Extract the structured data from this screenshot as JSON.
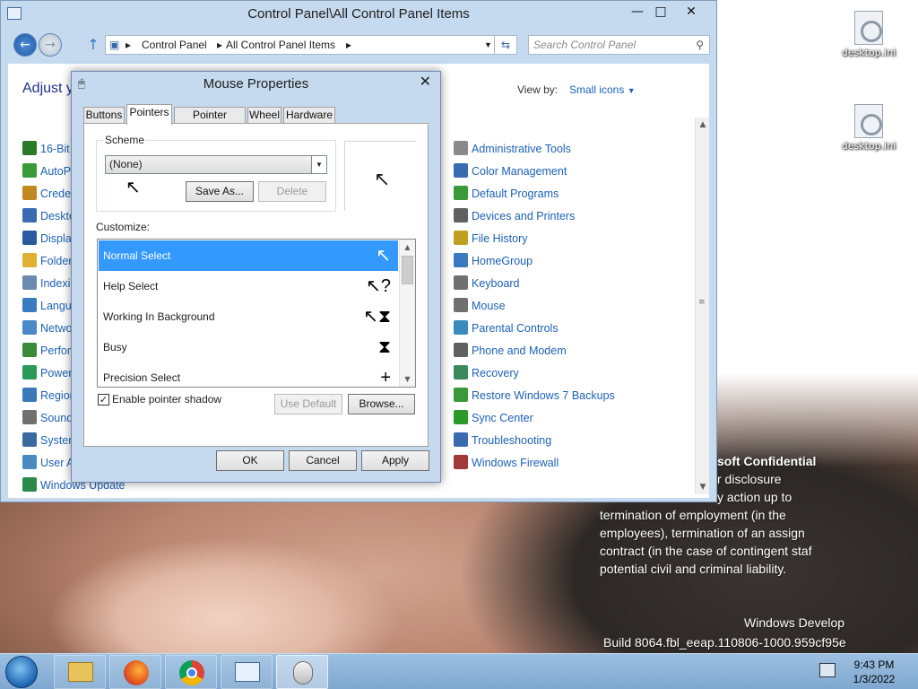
{
  "desktop": {
    "icons": [
      {
        "label": "desktop.ini"
      },
      {
        "label": "desktop.ini"
      }
    ],
    "watermark": {
      "line1": "soft Confidential",
      "line2": "r disclosure",
      "line3": "y action up to",
      "line4": "termination of employment (in the",
      "line5": "employees), termination of an assign",
      "line6": "contract (in the case of contingent staf",
      "line7": "potential civil and criminal liability.",
      "build_title": "Windows Develop",
      "build_number": "Build 8064.fbl_eeap.110806-1000.959cf95e"
    }
  },
  "control_panel": {
    "title": "Control Panel\\All Control Panel Items",
    "address": {
      "seg1": "Control Panel",
      "seg2": "All Control Panel Items"
    },
    "search_placeholder": "Search Control Panel",
    "heading": "Adjust y",
    "view_by_label": "View by:",
    "view_by_value": "Small icons",
    "left_items": [
      {
        "label": "16-Bit",
        "color": "#2a7a2a"
      },
      {
        "label": "AutoP",
        "color": "#3a9a3a"
      },
      {
        "label": "Creder",
        "color": "#c08a20"
      },
      {
        "label": "Deskto",
        "color": "#3a6ab0"
      },
      {
        "label": "Display",
        "color": "#2a5aa0"
      },
      {
        "label": "Folder",
        "color": "#e0b030"
      },
      {
        "label": "Indexin",
        "color": "#6a8ab0"
      },
      {
        "label": "Langua",
        "color": "#3a7ac0"
      },
      {
        "label": "Netwo",
        "color": "#4a8ac8"
      },
      {
        "label": "Perfor",
        "color": "#3a8a3a"
      },
      {
        "label": "Power",
        "color": "#2a9a5a"
      },
      {
        "label": "Region",
        "color": "#3a7ab8"
      },
      {
        "label": "Sound",
        "color": "#707070"
      },
      {
        "label": "System",
        "color": "#3a6aa0"
      },
      {
        "label": "User A",
        "color": "#4a8ac0"
      },
      {
        "label": "Windows Update",
        "color": "#2a8a4a"
      }
    ],
    "right_items": [
      {
        "label": "Administrative Tools",
        "color": "#8a8a8a"
      },
      {
        "label": "Color Management",
        "color": "#3a6ab0"
      },
      {
        "label": "Default Programs",
        "color": "#3a9a3a"
      },
      {
        "label": "Devices and Printers",
        "color": "#606060"
      },
      {
        "label": "File History",
        "color": "#c0a020"
      },
      {
        "label": "HomeGroup",
        "color": "#3a7ac0"
      },
      {
        "label": "Keyboard",
        "color": "#707070"
      },
      {
        "label": "Mouse",
        "color": "#707070"
      },
      {
        "label": "Parental Controls",
        "color": "#3a8ac0"
      },
      {
        "label": "Phone and Modem",
        "color": "#606060"
      },
      {
        "label": "Recovery",
        "color": "#3a8a5a"
      },
      {
        "label": "Restore Windows 7 Backups",
        "color": "#3a9a3a"
      },
      {
        "label": "Sync Center",
        "color": "#2a9a2a"
      },
      {
        "label": "Troubleshooting",
        "color": "#3a6ab0"
      },
      {
        "label": "Windows Firewall",
        "color": "#a03a3a"
      }
    ]
  },
  "mouse_properties": {
    "title": "Mouse Properties",
    "tabs": [
      {
        "label": "Buttons"
      },
      {
        "label": "Pointers"
      },
      {
        "label": "Pointer Options"
      },
      {
        "label": "Wheel"
      },
      {
        "label": "Hardware"
      }
    ],
    "scheme_label": "Scheme",
    "scheme_value": "(None)",
    "save_as_label": "Save As...",
    "delete_label": "Delete",
    "customize_label": "Customize:",
    "cursors": [
      {
        "label": "Normal Select",
        "glyph": "↖"
      },
      {
        "label": "Help Select",
        "glyph": "↖?"
      },
      {
        "label": "Working In Background",
        "glyph": "↖⧗"
      },
      {
        "label": "Busy",
        "glyph": "⧗"
      },
      {
        "label": "Precision Select",
        "glyph": "+"
      }
    ],
    "shadow_label": "Enable pointer shadow",
    "shadow_checked": "✓",
    "use_default_label": "Use Default",
    "browse_label": "Browse...",
    "ok_label": "OK",
    "cancel_label": "Cancel",
    "apply_label": "Apply"
  },
  "taskbar": {
    "time": "9:43 PM",
    "date": "1/3/2022"
  }
}
